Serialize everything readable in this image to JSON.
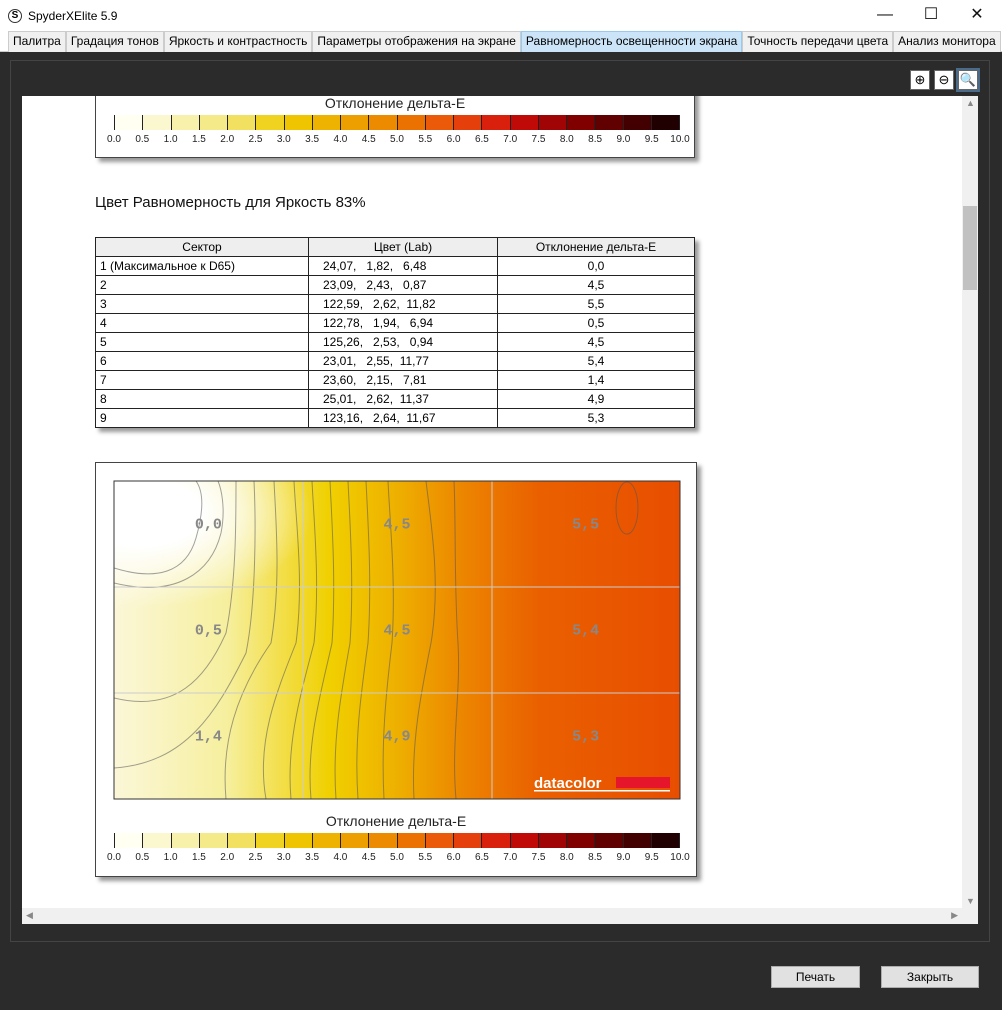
{
  "window": {
    "title": "SpyderXElite 5.9",
    "icon": "S",
    "minimize": "—",
    "maximize": "☐",
    "close": "✕"
  },
  "tabs": [
    "Палитра",
    "Градация тонов",
    "Яркость и контрастность",
    "Параметры отображения на экране",
    "Равномерность освещенности экрана",
    "Точность передачи цвета",
    "Анализ монитора"
  ],
  "active_tab": 4,
  "zoom_buttons": {
    "zoom_in": "⊕",
    "zoom_out": "⊖",
    "zoom_fit": "🔍"
  },
  "legend": {
    "title": "Отклонение дельта-E",
    "ticks": [
      "0.0",
      "0.5",
      "1.0",
      "1.5",
      "2.0",
      "2.5",
      "3.0",
      "3.5",
      "4.0",
      "4.5",
      "5.0",
      "5.5",
      "6.0",
      "6.5",
      "7.0",
      "7.5",
      "8.0",
      "8.5",
      "9.0",
      "9.5",
      "10.0"
    ],
    "colors": [
      "#fffff2",
      "#fbf8d0",
      "#f7f1ac",
      "#f4ea8a",
      "#f2e060",
      "#f0d320",
      "#efc400",
      "#eeb200",
      "#ed9f00",
      "#ec8a00",
      "#eb7200",
      "#ea5a08",
      "#e5400c",
      "#d8200c",
      "#c00a08",
      "#a00404",
      "#800000",
      "#600000",
      "#420000",
      "#200000"
    ]
  },
  "heading": "Цвет Равномерность для Яркость 83%",
  "table": {
    "headers": [
      "Сектор",
      "Цвет (Lab)",
      "Отклонение дельта-E"
    ],
    "rows": [
      [
        "1 (Максимальное к D65)",
        "24,07,   1,82,   6,48",
        "0,0"
      ],
      [
        "2",
        "23,09,   2,43,   0,87",
        "4,5"
      ],
      [
        "3",
        "122,59,   2,62,  11,82",
        "5,5"
      ],
      [
        "4",
        "122,78,   1,94,   6,94",
        "0,5"
      ],
      [
        "5",
        "125,26,   2,53,   0,94",
        "4,5"
      ],
      [
        "6",
        "23,01,   2,55,  11,77",
        "5,4"
      ],
      [
        "7",
        "23,60,   2,15,   7,81",
        "1,4"
      ],
      [
        "8",
        "25,01,   2,62,  11,37",
        "4,9"
      ],
      [
        "9",
        "123,16,   2,64,  11,67",
        "5,3"
      ]
    ]
  },
  "chart_data": {
    "type": "heatmap",
    "title": "",
    "colorbar_label": "Отклонение дельта-E",
    "range": [
      0,
      10
    ],
    "grid": [
      [
        "0,0",
        "4,5",
        "5,5"
      ],
      [
        "0,5",
        "4,5",
        "5,4"
      ],
      [
        "1,4",
        "4,9",
        "5,3"
      ]
    ],
    "values": [
      [
        0.0,
        4.5,
        5.5
      ],
      [
        0.5,
        4.5,
        5.4
      ],
      [
        1.4,
        4.9,
        5.3
      ]
    ],
    "logo": "datacolor"
  },
  "buttons": {
    "print": "Печать",
    "close": "Закрыть"
  }
}
